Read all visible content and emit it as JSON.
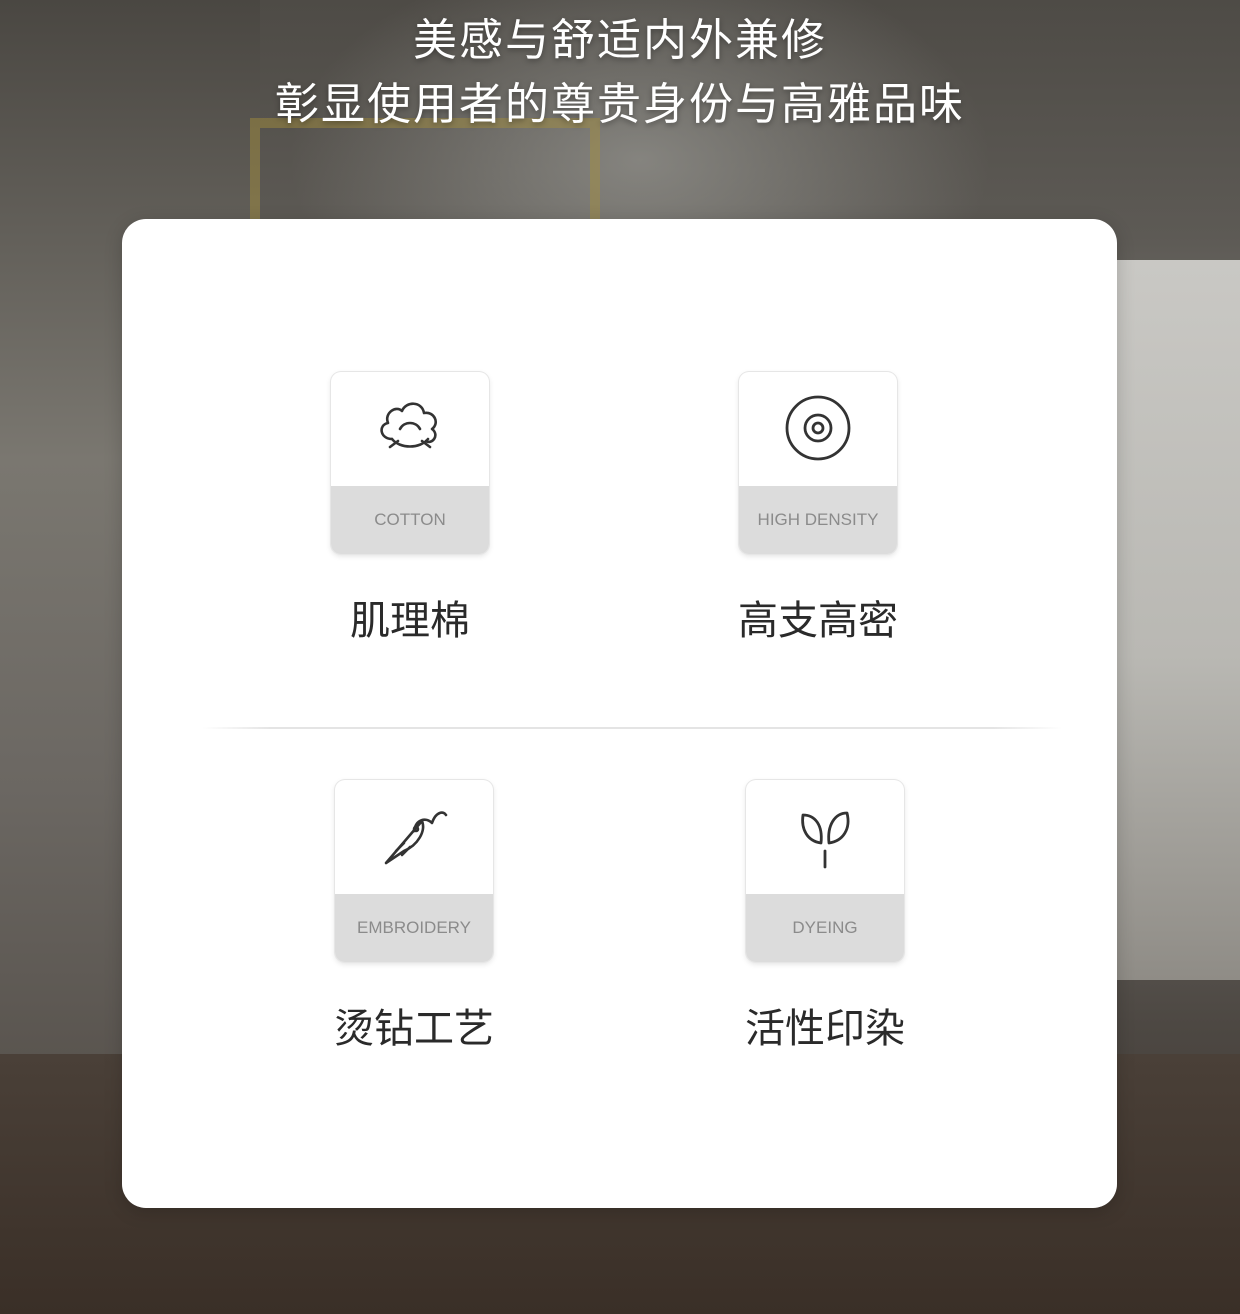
{
  "headline": {
    "line1": "美感与舒适内外兼修",
    "line2": "彰显使用者的尊贵身份与高雅品味"
  },
  "features": [
    {
      "icon": "cotton-icon",
      "label_en": "COTTON",
      "label_zh": "肌理棉"
    },
    {
      "icon": "target-icon",
      "label_en": "HIGH DENSITY",
      "label_zh": "高支高密"
    },
    {
      "icon": "needle-icon",
      "label_en": "EMBROIDERY",
      "label_zh": "烫钻工艺"
    },
    {
      "icon": "sprout-icon",
      "label_en": "DYEING",
      "label_zh": "活性印染"
    }
  ]
}
